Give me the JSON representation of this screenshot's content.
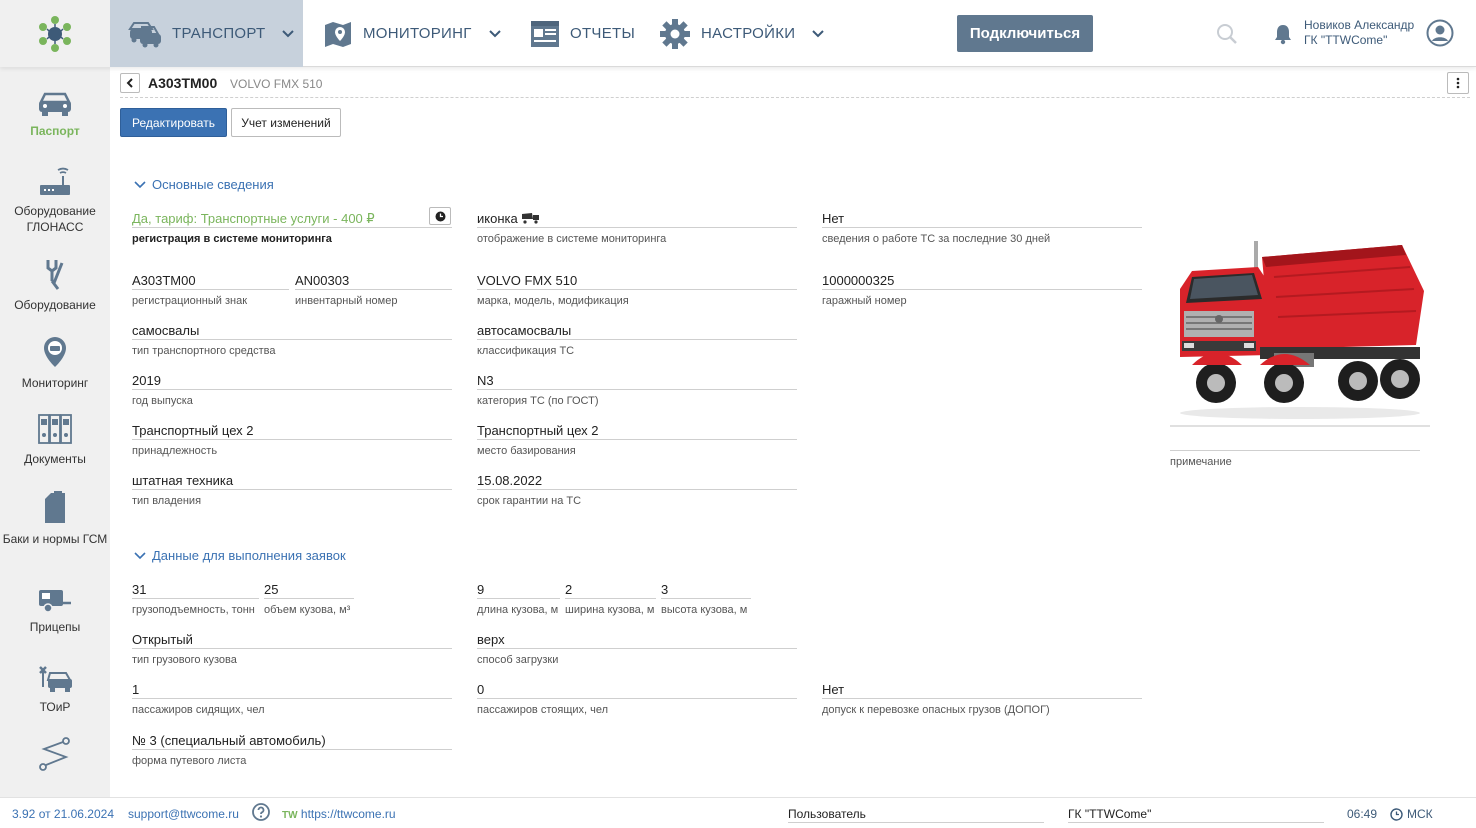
{
  "header": {
    "nav": [
      {
        "label": "ТРАНСПОРТ",
        "icon": "car-icon",
        "active": true
      },
      {
        "label": "МОНИТОРИНГ",
        "icon": "map-pin-icon"
      },
      {
        "label": "ОТЧЕТЫ",
        "icon": "report-icon"
      },
      {
        "label": "НАСТРОЙКИ",
        "icon": "gear-icon"
      }
    ],
    "connect_label": "Подключиться",
    "user_name": "Новиков Александр",
    "user_org": "ГК \"TTWCome\""
  },
  "sidebar": {
    "items": [
      {
        "label": "Паспорт",
        "icon": "car-icon",
        "active": true
      },
      {
        "label": "Оборудование ГЛОНАСС",
        "icon": "router-icon"
      },
      {
        "label": "Оборудование",
        "icon": "wrench-icon"
      },
      {
        "label": "Мониторинг",
        "icon": "map-pin-icon"
      },
      {
        "label": "Документы",
        "icon": "binders-icon"
      },
      {
        "label": "Баки и нормы ГСМ",
        "icon": "fuel-can-icon"
      },
      {
        "label": "Прицепы",
        "icon": "trailer-icon"
      },
      {
        "label": "ТОиР",
        "icon": "service-icon"
      },
      {
        "label": "",
        "icon": "route-icon"
      }
    ]
  },
  "vehicle": {
    "plate": "А303ТМ00",
    "model": "VOLVO FMX 510"
  },
  "actions": {
    "edit_label": "Редактировать",
    "history_label": "Учет изменений"
  },
  "sections": {
    "basic": "Основные сведения",
    "requests": "Данные для выполнения заявок"
  },
  "basic": {
    "registration": {
      "value": "Да, тариф: Транспортные услуги - 400 ₽",
      "label": "регистрация в системе мониторинга"
    },
    "icon": {
      "value": "иконка",
      "label": "отображение в системе мониторинга"
    },
    "work30": {
      "value": "Нет",
      "label": "сведения о работе ТС за последние 30 дней"
    },
    "reg_sign": {
      "value": "А303ТМ00",
      "label": "регистрационный знак"
    },
    "inv_no": {
      "value": "AN00303",
      "label": "инвентарный номер"
    },
    "make": {
      "value": "VOLVO FMX 510",
      "label": "марка, модель, модификация"
    },
    "garage_no": {
      "value": "1000000325",
      "label": "гаражный номер"
    },
    "vehicle_type": {
      "value": "самосвалы",
      "label": "тип транспортного средства"
    },
    "classification": {
      "value": "автосамосвалы",
      "label": "классификация ТС"
    },
    "year": {
      "value": "2019",
      "label": "год выпуска"
    },
    "category": {
      "value": "N3",
      "label": "категория ТС (по ГОСТ)"
    },
    "owner": {
      "value": "Транспортный цех 2",
      "label": "принадлежность"
    },
    "base": {
      "value": "Транспортный цех 2",
      "label": "место базирования"
    },
    "ownership": {
      "value": "штатная техника",
      "label": "тип владения"
    },
    "warranty": {
      "value": "15.08.2022",
      "label": "срок гарантии на ТС"
    },
    "note_label": "примечание"
  },
  "requests": {
    "capacity": {
      "value": "31",
      "label": "грузоподъемность, тонн"
    },
    "volume": {
      "value": "25",
      "label": "объем кузова, м³"
    },
    "length": {
      "value": "9",
      "label": "длина кузова, м"
    },
    "width": {
      "value": "2",
      "label": "ширина кузова, м"
    },
    "height": {
      "value": "3",
      "label": "высота кузова, м"
    },
    "body_type": {
      "value": "Открытый",
      "label": "тип грузового кузова"
    },
    "loading": {
      "value": "верх",
      "label": "способ загрузки"
    },
    "seated": {
      "value": "1",
      "label": "пассажиров сидящих, чел"
    },
    "standing": {
      "value": "0",
      "label": "пассажиров стоящих, чел"
    },
    "dangerous": {
      "value": "Нет",
      "label": "допуск к перевозке опасных грузов (ДОПОГ)"
    },
    "waybill": {
      "value": "№ 3 (специальный автомобиль)",
      "label": "форма путевого листа"
    }
  },
  "footer": {
    "version": "3.92 от 21.06.2024",
    "email": "support@ttwcome.ru",
    "tw": "TW",
    "site": "https://ttwcome.ru",
    "user": "Пользователь",
    "org": "ГК \"TTWCome\"",
    "time": "06:49",
    "timezone": "МСК"
  },
  "colors": {
    "accent": "#3b72b3",
    "green": "#7ab55c",
    "nav_active": "#c7d1dc",
    "truck_red": "#d8232a"
  }
}
